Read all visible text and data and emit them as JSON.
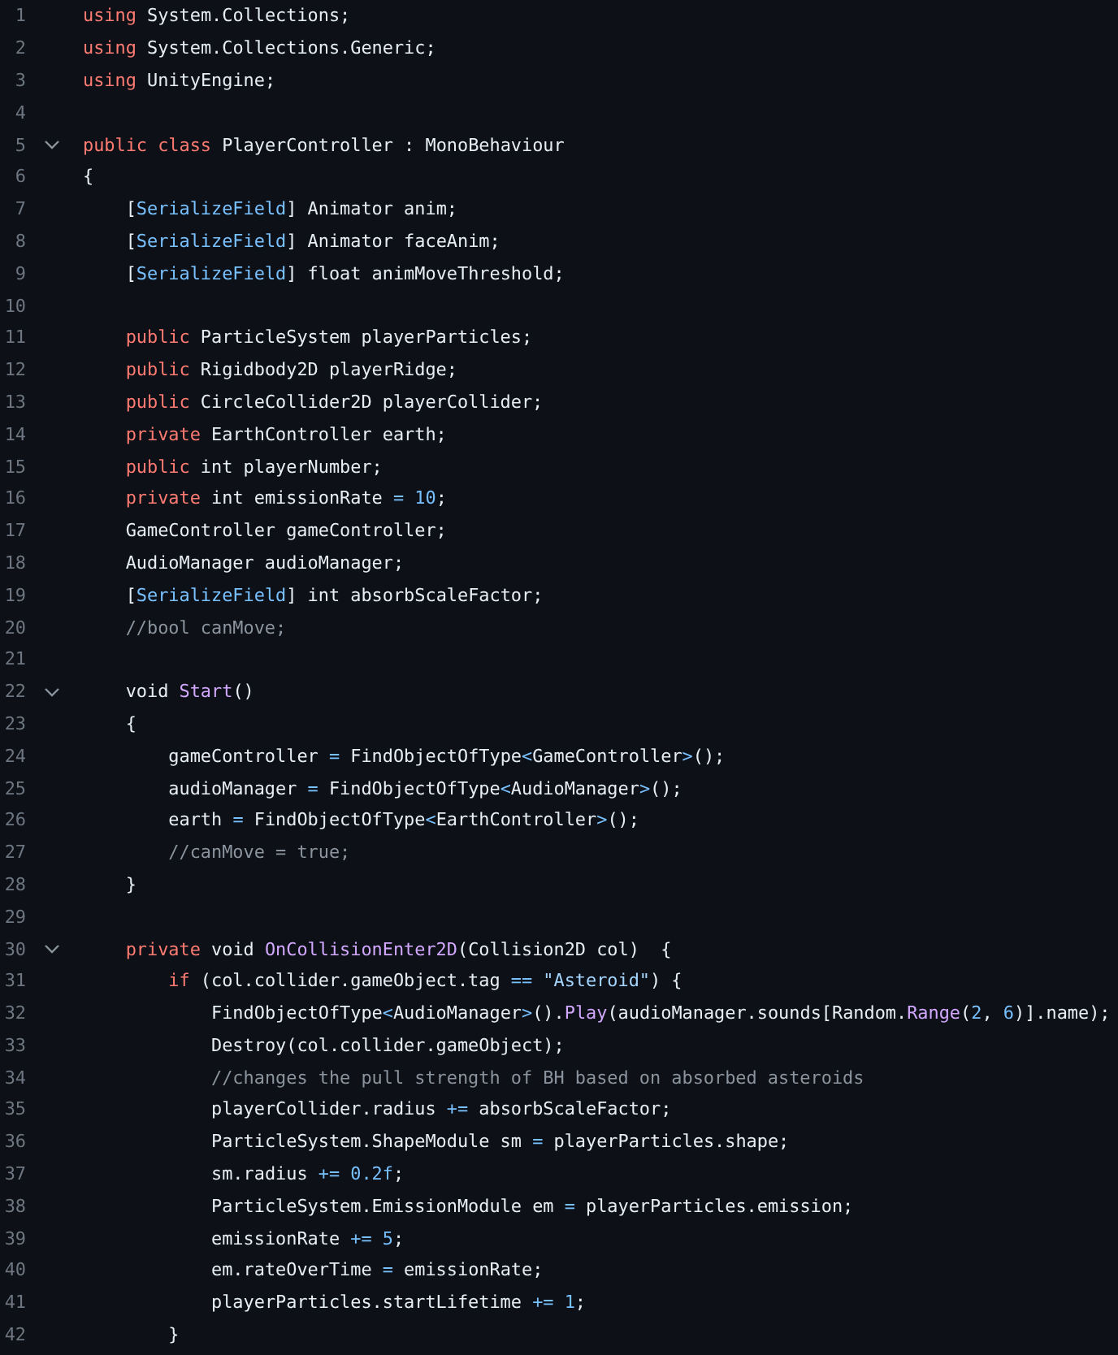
{
  "lines": [
    {
      "number": "1",
      "foldable": false,
      "tokens": [
        {
          "kind": "kw",
          "text": "using"
        },
        {
          "kind": "t",
          "text": " System.Collections;"
        }
      ]
    },
    {
      "number": "2",
      "foldable": false,
      "tokens": [
        {
          "kind": "kw",
          "text": "using"
        },
        {
          "kind": "t",
          "text": " System.Collections.Generic;"
        }
      ]
    },
    {
      "number": "3",
      "foldable": false,
      "tokens": [
        {
          "kind": "kw",
          "text": "using"
        },
        {
          "kind": "t",
          "text": " UnityEngine;"
        }
      ]
    },
    {
      "number": "4",
      "foldable": false
    },
    {
      "number": "5",
      "foldable": true,
      "tokens": [
        {
          "kind": "kw",
          "text": "public class"
        },
        {
          "kind": "t",
          "text": " PlayerController : MonoBehaviour"
        }
      ]
    },
    {
      "number": "6",
      "foldable": false,
      "tokens": [
        {
          "kind": "t",
          "text": "{"
        }
      ],
      "children": [
        {
          "number": "7",
          "foldable": false,
          "tokens": [
            {
              "kind": "t",
              "text": "["
            },
            {
              "kind": "attr",
              "text": "SerializeField"
            },
            {
              "kind": "t",
              "text": "] Animator anim;"
            }
          ]
        },
        {
          "number": "8",
          "foldable": false,
          "tokens": [
            {
              "kind": "t",
              "text": "["
            },
            {
              "kind": "attr",
              "text": "SerializeField"
            },
            {
              "kind": "t",
              "text": "] Animator faceAnim;"
            }
          ]
        },
        {
          "number": "9",
          "foldable": false,
          "tokens": [
            {
              "kind": "t",
              "text": "["
            },
            {
              "kind": "attr",
              "text": "SerializeField"
            },
            {
              "kind": "t",
              "text": "] float animMoveThreshold;"
            }
          ]
        },
        {
          "number": "10",
          "foldable": false
        },
        {
          "number": "11",
          "foldable": false,
          "tokens": [
            {
              "kind": "kw",
              "text": "public"
            },
            {
              "kind": "t",
              "text": " ParticleSystem playerParticles;"
            }
          ]
        },
        {
          "number": "12",
          "foldable": false,
          "tokens": [
            {
              "kind": "kw",
              "text": "public"
            },
            {
              "kind": "t",
              "text": " Rigidbody2D playerRidge;"
            }
          ]
        },
        {
          "number": "13",
          "foldable": false,
          "tokens": [
            {
              "kind": "kw",
              "text": "public"
            },
            {
              "kind": "t",
              "text": " CircleCollider2D playerCollider;"
            }
          ]
        },
        {
          "number": "14",
          "foldable": false,
          "tokens": [
            {
              "kind": "kw",
              "text": "private"
            },
            {
              "kind": "t",
              "text": " EarthController earth;"
            }
          ]
        },
        {
          "number": "15",
          "foldable": false,
          "tokens": [
            {
              "kind": "kw",
              "text": "public"
            },
            {
              "kind": "t",
              "text": " int playerNumber;"
            }
          ]
        },
        {
          "number": "16",
          "foldable": false,
          "tokens": [
            {
              "kind": "kw",
              "text": "private"
            },
            {
              "kind": "t",
              "text": " int emissionRate "
            },
            {
              "kind": "op",
              "text": "="
            },
            {
              "kind": "num",
              "text": " 10"
            },
            {
              "kind": "t",
              "text": ";"
            }
          ]
        },
        {
          "number": "17",
          "foldable": false,
          "tokens": [
            {
              "kind": "t",
              "text": "GameController gameController;"
            }
          ]
        },
        {
          "number": "18",
          "foldable": false,
          "tokens": [
            {
              "kind": "t",
              "text": "AudioManager audioManager;"
            }
          ]
        },
        {
          "number": "19",
          "foldable": false,
          "tokens": [
            {
              "kind": "t",
              "text": "["
            },
            {
              "kind": "attr",
              "text": "SerializeField"
            },
            {
              "kind": "t",
              "text": "] int absorbScaleFactor;"
            }
          ]
        },
        {
          "number": "20",
          "foldable": false,
          "tokens": [
            {
              "kind": "cm",
              "text": "//bool canMove;"
            }
          ]
        },
        {
          "number": "21",
          "foldable": false
        },
        {
          "number": "22",
          "foldable": true,
          "tokens": [
            {
              "kind": "t",
              "text": "void "
            },
            {
              "kind": "fn",
              "text": "Start"
            },
            {
              "kind": "t",
              "text": "()"
            }
          ]
        },
        {
          "number": "23",
          "foldable": false,
          "tokens": [
            {
              "kind": "t",
              "text": "{"
            }
          ],
          "children": [
            {
              "number": "24",
              "foldable": false,
              "tokens": [
                {
                  "kind": "t",
                  "text": "gameController "
                },
                {
                  "kind": "op",
                  "text": "="
                },
                {
                  "kind": "t",
                  "text": " FindObjectOfType"
                },
                {
                  "kind": "op",
                  "text": "<"
                },
                {
                  "kind": "t",
                  "text": "GameController"
                },
                {
                  "kind": "op",
                  "text": ">"
                },
                {
                  "kind": "t",
                  "text": "();"
                }
              ]
            },
            {
              "number": "25",
              "foldable": false,
              "tokens": [
                {
                  "kind": "t",
                  "text": "audioManager "
                },
                {
                  "kind": "op",
                  "text": "="
                },
                {
                  "kind": "t",
                  "text": " FindObjectOfType"
                },
                {
                  "kind": "op",
                  "text": "<"
                },
                {
                  "kind": "t",
                  "text": "AudioManager"
                },
                {
                  "kind": "op",
                  "text": ">"
                },
                {
                  "kind": "t",
                  "text": "();"
                }
              ]
            },
            {
              "number": "26",
              "foldable": false,
              "tokens": [
                {
                  "kind": "t",
                  "text": "earth "
                },
                {
                  "kind": "op",
                  "text": "="
                },
                {
                  "kind": "t",
                  "text": " FindObjectOfType"
                },
                {
                  "kind": "op",
                  "text": "<"
                },
                {
                  "kind": "t",
                  "text": "EarthController"
                },
                {
                  "kind": "op",
                  "text": ">"
                },
                {
                  "kind": "t",
                  "text": "();"
                }
              ]
            },
            {
              "number": "27",
              "foldable": false,
              "tokens": [
                {
                  "kind": "cm",
                  "text": "//canMove = true;"
                }
              ]
            }
          ]
        },
        {
          "number": "28",
          "foldable": false,
          "tokens": [
            {
              "kind": "t",
              "text": "}"
            }
          ]
        },
        {
          "number": "29",
          "foldable": false
        },
        {
          "number": "30",
          "foldable": true,
          "tokens": [
            {
              "kind": "kw",
              "text": "private"
            },
            {
              "kind": "t",
              "text": " void "
            },
            {
              "kind": "fn",
              "text": "OnCollisionEnter2D"
            },
            {
              "kind": "t",
              "text": "(Collision2D col)  {"
            }
          ],
          "children": [
            {
              "number": "31",
              "foldable": false,
              "tokens": [
                {
                  "kind": "kw",
                  "text": "if"
                },
                {
                  "kind": "t",
                  "text": " (col.collider.gameObject.tag "
                },
                {
                  "kind": "op",
                  "text": "=="
                },
                {
                  "kind": "str",
                  "text": " \"Asteroid\""
                },
                {
                  "kind": "t",
                  "text": ") {"
                }
              ],
              "children": [
                {
                  "number": "32",
                  "foldable": false,
                  "tokens": [
                    {
                      "kind": "t",
                      "text": "FindObjectOfType"
                    },
                    {
                      "kind": "op",
                      "text": "<"
                    },
                    {
                      "kind": "t",
                      "text": "AudioManager"
                    },
                    {
                      "kind": "op",
                      "text": ">"
                    },
                    {
                      "kind": "t",
                      "text": "()."
                    },
                    {
                      "kind": "fn",
                      "text": "Play"
                    },
                    {
                      "kind": "t",
                      "text": "(audioManager.sounds[Random."
                    },
                    {
                      "kind": "fn",
                      "text": "Range"
                    },
                    {
                      "kind": "t",
                      "text": "("
                    },
                    {
                      "kind": "num",
                      "text": "2"
                    },
                    {
                      "kind": "t",
                      "text": ", "
                    },
                    {
                      "kind": "num",
                      "text": "6"
                    },
                    {
                      "kind": "t",
                      "text": ")].name);"
                    }
                  ]
                },
                {
                  "number": "33",
                  "foldable": false,
                  "tokens": [
                    {
                      "kind": "t",
                      "text": "Destroy(col.collider.gameObject);"
                    }
                  ]
                },
                {
                  "number": "34",
                  "foldable": false,
                  "tokens": [
                    {
                      "kind": "cm",
                      "text": "//changes the pull strength of BH based on absorbed asteroids"
                    }
                  ]
                },
                {
                  "number": "35",
                  "foldable": false,
                  "tokens": [
                    {
                      "kind": "t",
                      "text": "playerCollider.radius "
                    },
                    {
                      "kind": "op",
                      "text": "+="
                    },
                    {
                      "kind": "t",
                      "text": " absorbScaleFactor;"
                    }
                  ]
                },
                {
                  "number": "36",
                  "foldable": false,
                  "tokens": [
                    {
                      "kind": "t",
                      "text": "ParticleSystem.ShapeModule sm "
                    },
                    {
                      "kind": "op",
                      "text": "="
                    },
                    {
                      "kind": "t",
                      "text": " playerParticles.shape;"
                    }
                  ]
                },
                {
                  "number": "37",
                  "foldable": false,
                  "tokens": [
                    {
                      "kind": "t",
                      "text": "sm.radius "
                    },
                    {
                      "kind": "op",
                      "text": "+="
                    },
                    {
                      "kind": "num",
                      "text": " 0.2f"
                    },
                    {
                      "kind": "t",
                      "text": ";"
                    }
                  ]
                },
                {
                  "number": "38",
                  "foldable": false,
                  "tokens": [
                    {
                      "kind": "t",
                      "text": "ParticleSystem.EmissionModule em "
                    },
                    {
                      "kind": "op",
                      "text": "="
                    },
                    {
                      "kind": "t",
                      "text": " playerParticles.emission;"
                    }
                  ]
                },
                {
                  "number": "39",
                  "foldable": false,
                  "tokens": [
                    {
                      "kind": "t",
                      "text": "emissionRate "
                    },
                    {
                      "kind": "op",
                      "text": "+="
                    },
                    {
                      "kind": "num",
                      "text": " 5"
                    },
                    {
                      "kind": "t",
                      "text": ";"
                    }
                  ]
                },
                {
                  "number": "40",
                  "foldable": false,
                  "tokens": [
                    {
                      "kind": "t",
                      "text": "em.rateOverTime "
                    },
                    {
                      "kind": "op",
                      "text": "="
                    },
                    {
                      "kind": "t",
                      "text": " emissionRate;"
                    }
                  ]
                },
                {
                  "number": "41",
                  "foldable": false,
                  "tokens": [
                    {
                      "kind": "t",
                      "text": "playerParticles.startLifetime "
                    },
                    {
                      "kind": "op",
                      "text": "+="
                    },
                    {
                      "kind": "num",
                      "text": " 1"
                    },
                    {
                      "kind": "t",
                      "text": ";"
                    }
                  ]
                }
              ]
            },
            {
              "number": "42",
              "foldable": false,
              "tokens": [
                {
                  "kind": "t",
                  "text": "}"
                }
              ]
            }
          ]
        }
      ]
    }
  ]
}
